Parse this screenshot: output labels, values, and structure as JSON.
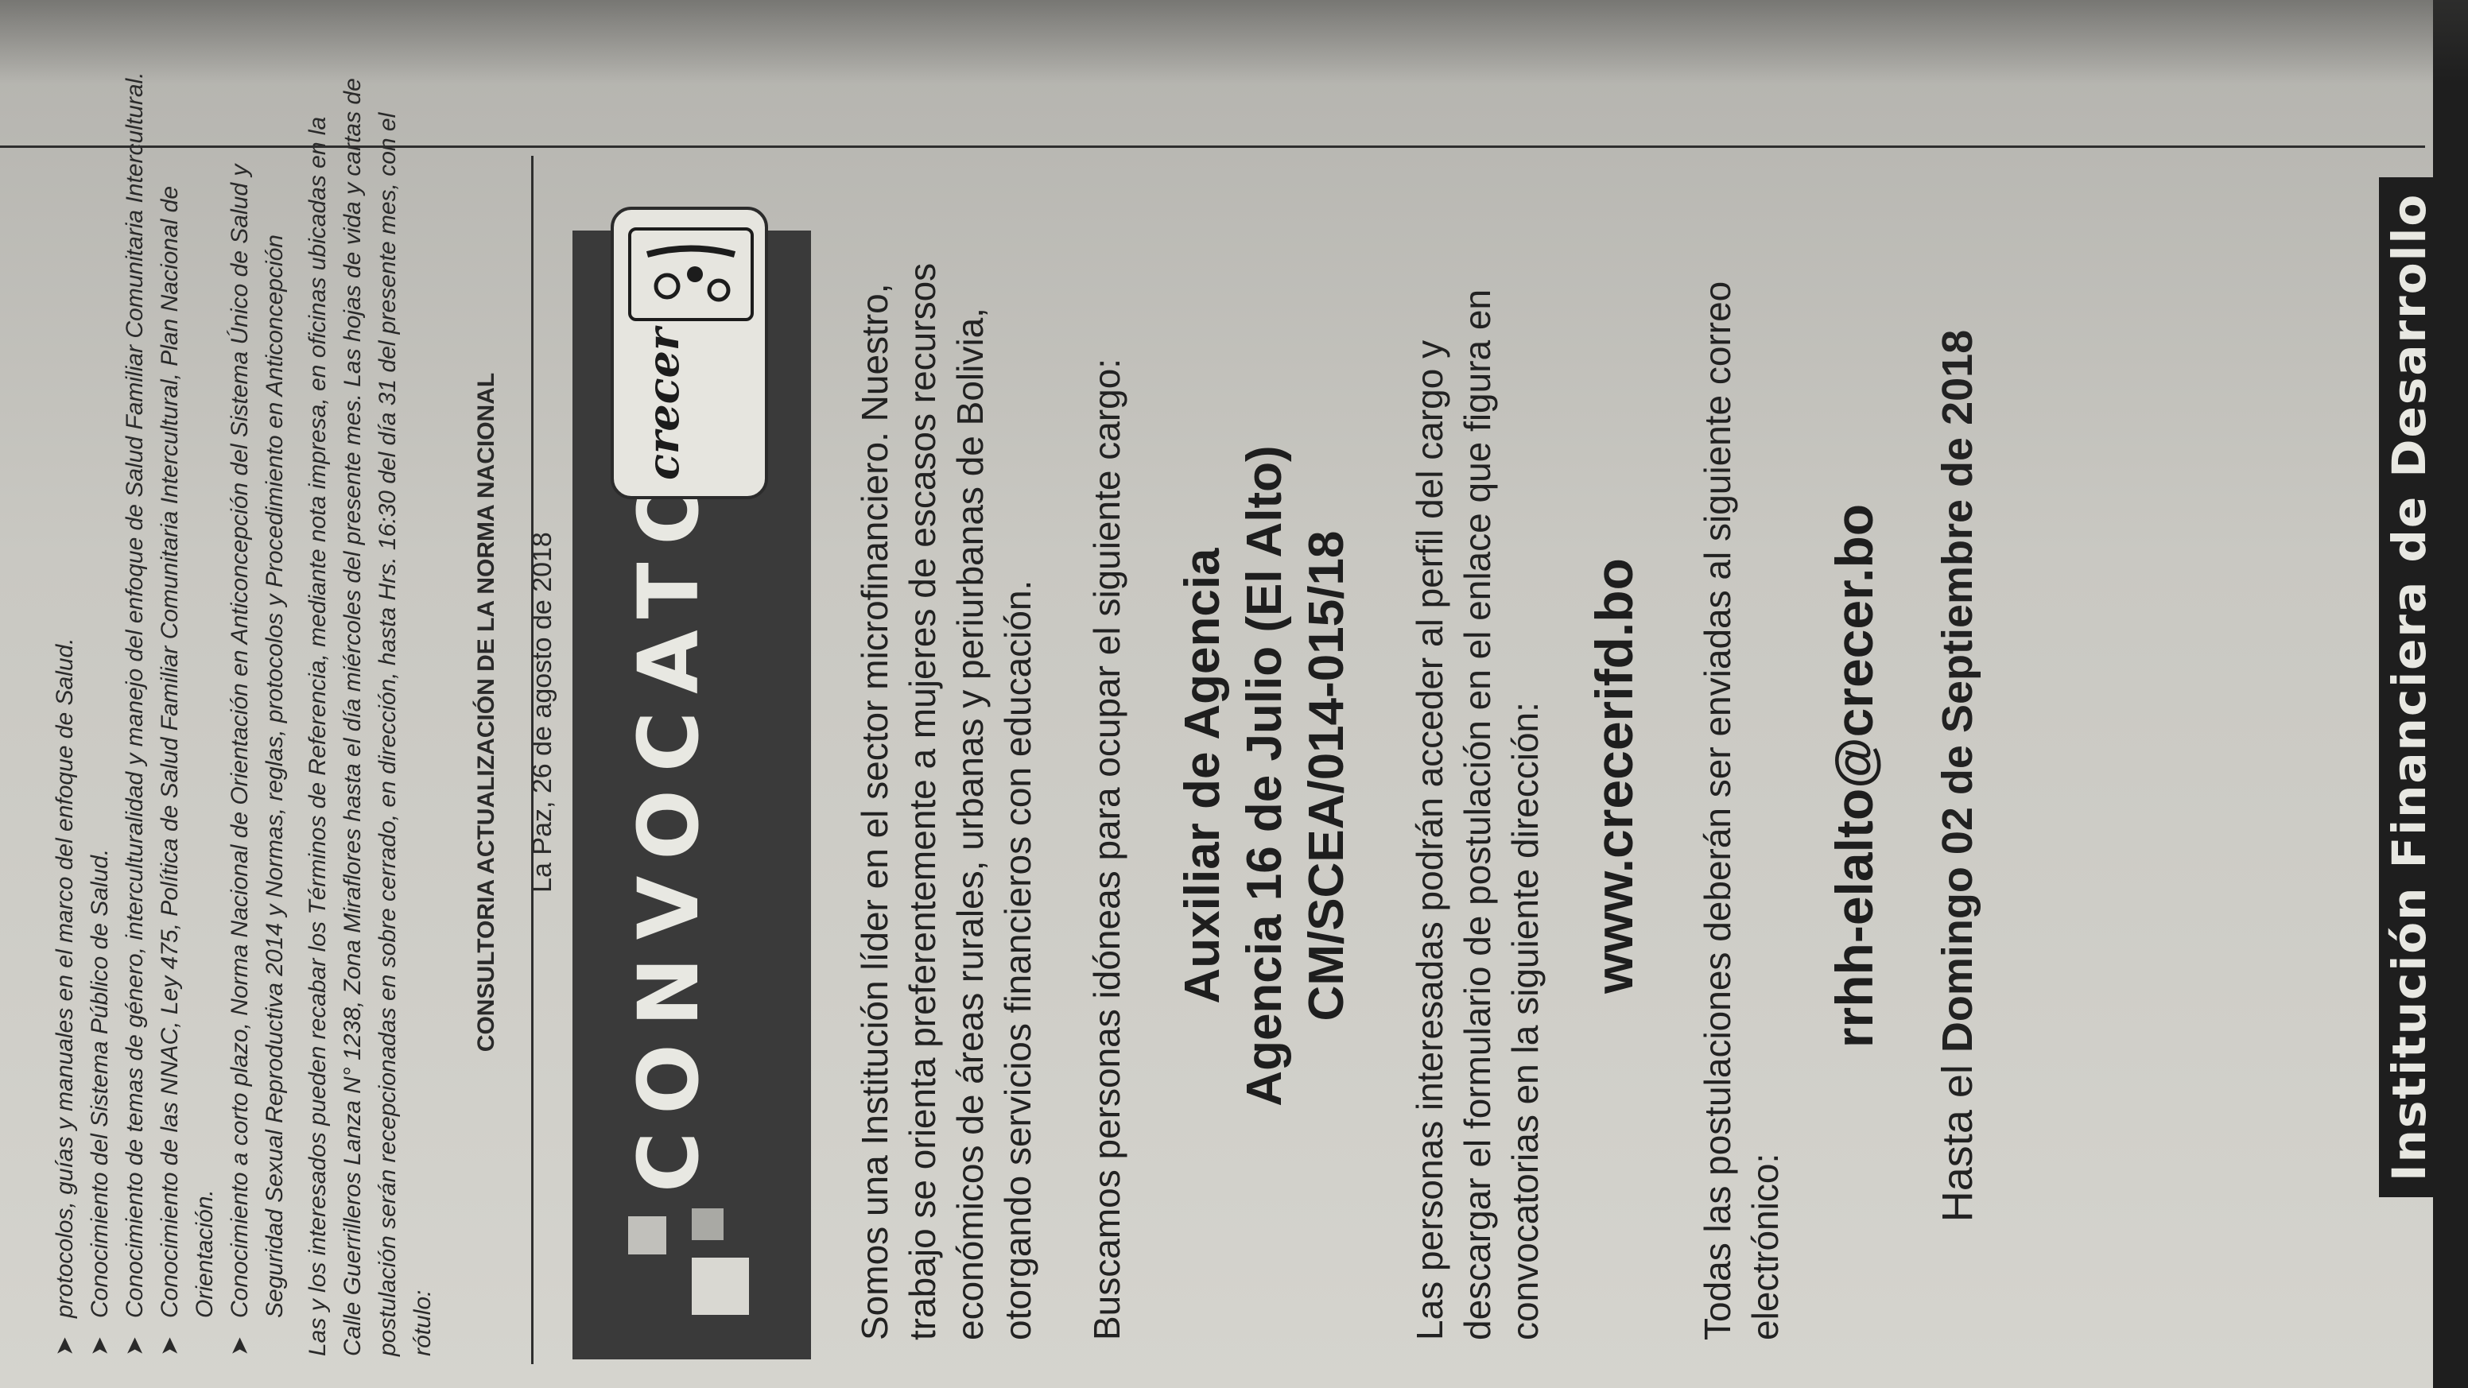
{
  "previous_article": {
    "bullets": [
      "protocolos, guías y manuales en el marco del enfoque de Salud.",
      "Conocimiento del Sistema Público de Salud.",
      "Conocimiento de temas de género, interculturalidad y manejo del enfoque de Salud Familiar Comunitaria Intercultural.",
      "Conocimiento de las NNAC, Ley 475, Política de Salud Familiar Comunitaria Intercultural, Plan Nacional de Orientación.",
      "Conocimiento a corto plazo, Norma Nacional de Orientación en Anticoncepción del Sistema Único de Salud y Seguridad Sexual Reproductiva 2014 y Normas, reglas, protocolos y Procedimiento en Anticoncepción"
    ],
    "paragraph": "Las y los interesados pueden recabar los Términos de Referencia, mediante nota impresa, en oficinas ubicadas en la Calle Guerrilleros Lanza N° 1238, Zona Miraflores hasta el día miércoles del presente mes. Las hojas de vida y cartas de postulación serán recepcionadas en sobre cerrado, en dirección, hasta Hrs. 16:30 del día 31 del presente mes, con el rótulo:",
    "rotulo": "CONSULTORIA ACTUALIZACIÓN DE LA NORMA NACIONAL",
    "place_date": "La Paz, 26 de agosto de 2018"
  },
  "convocatoria": {
    "title": "CONVOCATORIA",
    "logo_text": "crecer",
    "intro": "Somos una Institución líder en el sector microfinanciero. Nuestro, trabajo se orienta preferentemente a mujeres de escasos recursos económicos de áreas rurales, urbanas y periurbanas de Bolivia, otorgando servicios financieros con educación.",
    "search_line": "Buscamos personas idóneas para ocupar el siguiente cargo:",
    "position_lines": [
      "Auxiliar de Agencia",
      "Agencia 16 de Julio (El Alto)",
      "CM/SCEA/014-015/18"
    ],
    "access_text": "Las personas interesadas podrán acceder al perfil del cargo y descargar el formulario de postulación en el enlace que figura en convocatorias en la siguiente dirección:",
    "website": "www.crecerifd.bo",
    "send_text": "Todas las postulaciones deberán ser enviadas al siguiente correo electrónico:",
    "email": "rrhh-elalto@crecer.bo",
    "deadline_prefix": "Hasta el",
    "deadline_bold": "Domingo 02 de Septiembre de 2018"
  },
  "next_ad": {
    "title": "Institución Financiera de Desarrollo"
  }
}
